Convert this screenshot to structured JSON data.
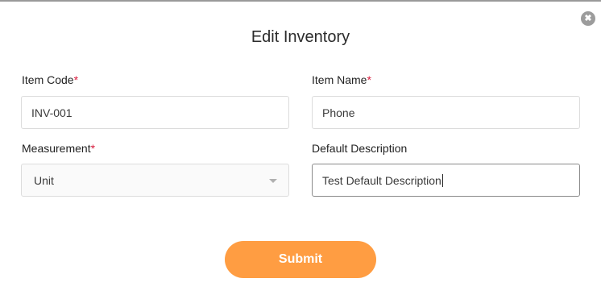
{
  "modal": {
    "title": "Edit Inventory",
    "close_icon": "close-icon"
  },
  "form": {
    "required_marker": "*",
    "item_code": {
      "label": "Item Code",
      "value": "INV-001",
      "required": true
    },
    "item_name": {
      "label": "Item Name",
      "value": "Phone",
      "required": true
    },
    "measurement": {
      "label": "Measurement",
      "value": "Unit",
      "required": true
    },
    "default_description": {
      "label": "Default Description",
      "value": "Test Default Description",
      "required": false
    }
  },
  "actions": {
    "submit_label": "Submit"
  },
  "colors": {
    "submit_bg": "#ff9d42",
    "required_marker": "#d81b3c",
    "close_bg": "#9c9c9c"
  }
}
